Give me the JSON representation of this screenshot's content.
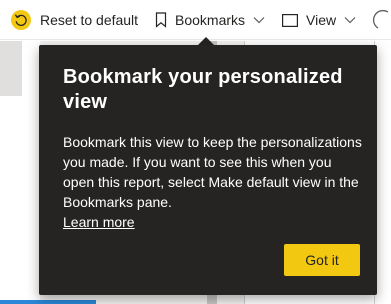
{
  "toolbar": {
    "reset_label": "Reset to default",
    "bookmarks_label": "Bookmarks",
    "view_label": "View",
    "icons": {
      "reset": "undo-circle-icon",
      "bookmarks": "bookmark-icon",
      "view": "view-window-icon",
      "chevron": "chevron-down-icon",
      "more": "more-icon"
    }
  },
  "coachmark": {
    "title": "Bookmark your personalized view",
    "body": "Bookmark this view to keep the personalizations you made. If you want to see this when you open this report, select Make default view in the Bookmarks pane.",
    "link": "Learn more",
    "button": "Got it"
  },
  "colors": {
    "coachmark_bg": "#252423",
    "button_bg": "#f2c811",
    "reset_icon_fill": "#f2c811",
    "text_dark": "#252423",
    "accent_blue": "#2b88d8"
  }
}
